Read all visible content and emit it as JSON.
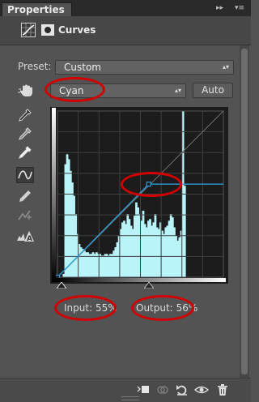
{
  "tab": {
    "title": "Properties",
    "collapse_glyph": "▸▸",
    "menu_glyph": "▾≡"
  },
  "header": {
    "title": "Curves",
    "adjustment_icon": "curves-adjustment-icon",
    "mask_icon": "mask-icon"
  },
  "preset": {
    "label": "Preset:",
    "value": "Custom"
  },
  "channel": {
    "value": "Cyan",
    "auto_label": "Auto"
  },
  "tools": [
    "on-image-adjust-hand-icon",
    "sample-black-eyedropper-icon",
    "sample-gray-eyedropper-icon",
    "sample-white-eyedropper-icon",
    "edit-curve-points-icon",
    "draw-curve-pencil-icon",
    "smooth-curve-icon",
    "clipping-warning-icon"
  ],
  "readouts": {
    "input_label": "Input:",
    "input_value": "55%",
    "output_label": "Output:",
    "output_value": "56%"
  },
  "curve": {
    "channel_color": "#2e9bd6",
    "histogram_color": "#b8f4f9",
    "points": [
      [
        0,
        0
      ],
      [
        55,
        56
      ],
      [
        100,
        56
      ]
    ],
    "histogram": [
      0,
      0,
      0,
      2,
      68,
      74,
      71,
      64,
      57,
      49,
      38,
      26,
      20,
      18,
      17,
      16,
      15,
      15,
      14,
      14,
      15,
      14,
      15,
      14,
      14,
      13,
      13,
      14,
      14,
      13,
      14,
      14,
      16,
      18,
      21,
      25,
      29,
      33,
      34,
      32,
      38,
      35,
      31,
      29,
      37,
      45,
      42,
      38,
      34,
      40,
      32,
      30,
      34,
      35,
      31,
      33,
      38,
      30,
      29,
      33,
      28,
      26,
      30,
      31,
      34,
      38,
      36,
      30,
      25,
      22,
      24,
      28,
      100,
      55,
      0,
      0,
      0,
      0,
      0,
      0,
      0,
      0,
      0,
      0,
      0,
      0,
      0,
      0,
      0,
      0,
      0,
      0,
      0,
      0,
      0,
      0
    ]
  },
  "annotation_color": "#d40000",
  "footer": {
    "icons": [
      "clip-to-layer-icon",
      "view-previous-state-icon",
      "reset-icon",
      "toggle-visibility-icon",
      "delete-icon"
    ]
  }
}
